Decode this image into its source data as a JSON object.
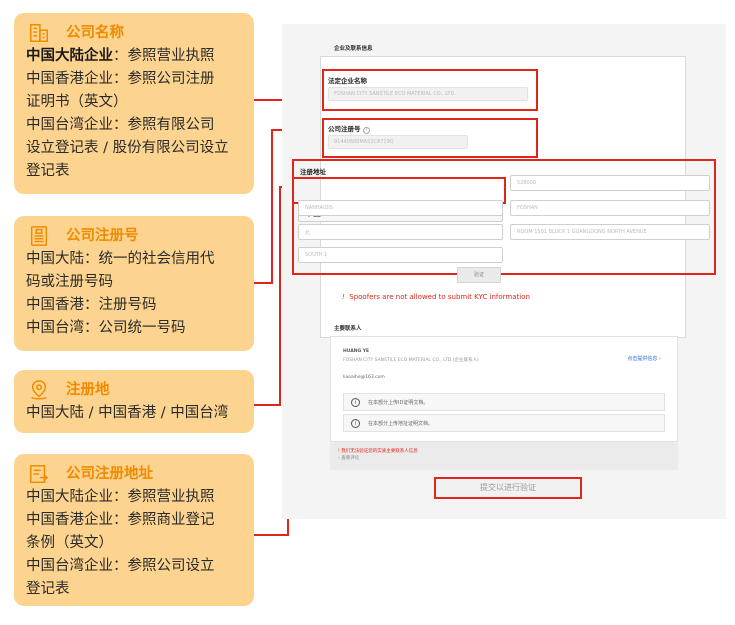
{
  "callouts": {
    "company_name": {
      "icon": "building-icon",
      "title": "公司名称",
      "lead_bold": "中国大陆企业",
      "lead_rest": "：参照营业执照",
      "lines": [
        "中国香港企业：参照公司注册",
        "证明书（英文）",
        "中国台湾企业：参照有限公司",
        "设立登记表 / 股份有限公司设立",
        "登记表"
      ]
    },
    "registration_number": {
      "icon": "document-list-icon",
      "title": "公司注册号",
      "lines": [
        "中国大陆：统一的社会信用代",
        "码或注册号码",
        "中国香港：注册号码",
        "中国台湾：公司统一号码"
      ]
    },
    "registration_place": {
      "icon": "location-pin-icon",
      "title": "注册地",
      "lines": [
        "中国大陆 / 中国香港 / 中国台湾"
      ]
    },
    "registered_address": {
      "icon": "form-icon",
      "title": "公司注册地址",
      "lines": [
        "中国大陆企业：参照营业执照",
        "中国香港企业：参照商业登记",
        "条例（英文）",
        "中国台湾企业：参照公司设立",
        "登记表"
      ]
    }
  },
  "form": {
    "section_title": "企业及联系信息",
    "legal_name_label": "法定企业名称",
    "legal_name_value": "FOSHAN CITY SANSTILE ECO MATERIAL CO., LTD.",
    "reg_no_label": "公司注册号",
    "reg_no_value": "91440600MA52C8719Q",
    "address_label": "注册地址",
    "country_selected": "中国",
    "address_fields": [
      "528000",
      "NANHAIDIS",
      "FOSHAN",
      "北",
      "ROOM 1501 BLOCK 1 GUANGDONG NORTH AVENUE",
      "SOUTH 1"
    ],
    "verify_small": "验证",
    "spoof_warning": "Spoofers are not allowed to submit KYC information",
    "contact_section_title": "主要联系人",
    "contact_name": "HUANG YE",
    "contact_company": "FOSHAN CITY SANSTILE ECO MATERIAL CO., LTD.(企业联系人)",
    "contact_email": "liaoaihe@163.com",
    "contact_link": "点击提供信息 ›",
    "upload_id": "在本部分上传ID证明文档。",
    "upload_address": "在本部分上传地址证明文档。",
    "notice_red": "我们无法验证您的实质主要联系人信息",
    "notice_grey": "› 查看评论",
    "submit_label": "提交以进行验证"
  },
  "colors": {
    "callout_bg": "#fdd48f",
    "callout_title": "#f08a00",
    "highlight_red": "#e0261c"
  }
}
